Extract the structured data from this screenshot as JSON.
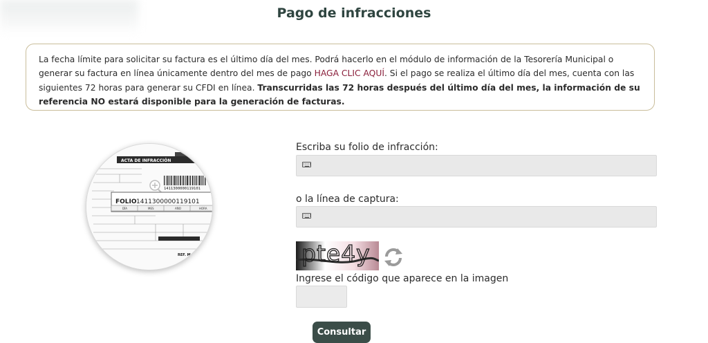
{
  "page": {
    "title": "Pago de infracciones"
  },
  "notice": {
    "text_1": "La fecha límite para solicitar su factura es el último día del mes. Podrá hacerlo en el módulo de información de la Tesorería Municipal o generar su factura en línea únicamente dentro del mes de pago ",
    "link": "HAGA CLIC AQUÍ",
    "text_2": ". Si el pago se realiza el último día del mes, cuenta con las siguientes 72 horas para generar su CFDI en línea. ",
    "bold": "Transcurridas las 72 horas después del último día del mes, la información de su referencia NO estará disponible para la generación de facturas.",
    "link_color": "#8a1f3b"
  },
  "ticket_image": {
    "header": "ACTA DE INFRACCIÓN",
    "folio_label": "FOLIO",
    "folio_number": "1411300000119101",
    "barcode_number": "1411300000119101",
    "columns": [
      "DÍA",
      "MES",
      "AÑO",
      "HORA"
    ],
    "ref": "REF. M"
  },
  "form": {
    "folio_label": "Escriba su folio de infracción:",
    "folio_value": "",
    "linea_label": "o la línea de captura:",
    "linea_value": "",
    "captcha_text": "pte4y",
    "captcha_label": "Ingrese el código que aparece en la imagen",
    "captcha_value": "",
    "submit_label": "Consultar"
  },
  "icons": {
    "field_icon": "keyboard-icon",
    "refresh_icon": "refresh-icon"
  },
  "colors": {
    "title": "#2f4540",
    "button": "#3b4d48",
    "notice_border": "#c9bd9a",
    "field_bg": "#e9e9e9"
  }
}
